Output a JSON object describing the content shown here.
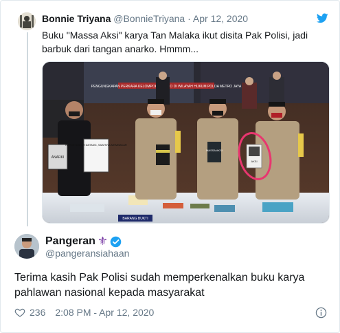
{
  "parent_tweet": {
    "author_name": "Bonnie Triyana",
    "author_handle": "@BonnieTriyana",
    "separator": "·",
    "date": "Apr 12, 2020",
    "text": "Buku \"Massa Aksi\" karya Tan Malaka ikut disita Pak Polisi, jadi barbuk dari tangan anarko. Hmmm...",
    "photo": {
      "backdrop_banner": "PENGUNGKAPAN PERKARA KELOMPOK ANARKO DI WILAYAH HUKUM POLDA METRO JAYA",
      "table_label": "BARANG BUKTI",
      "book_title_left": "ANARKI",
      "book_title_mid": "MASSA AKSI",
      "book_title_right": "AKSI",
      "sign_text": "KRISIS SUDAH DATANG, SAATNYA MEMBAKAR",
      "highlight_color": "#e8366f"
    }
  },
  "main_tweet": {
    "author_name": "Pangeran",
    "badge_emoji": "⚜",
    "author_handle": "@pangeransiahaan",
    "text": "Terima kasih Pak Polisi sudah memperkenalkan buku karya pahlawan nasional kepada masyarakat",
    "likes": "236",
    "time": "2:08 PM - Apr 12, 2020"
  },
  "colors": {
    "twitter_blue": "#1da1f2",
    "text_secondary": "#657786",
    "border": "#e1e8ed"
  },
  "icons": [
    "twitter-bird-icon",
    "verified-badge-icon",
    "heart-icon",
    "info-icon"
  ]
}
